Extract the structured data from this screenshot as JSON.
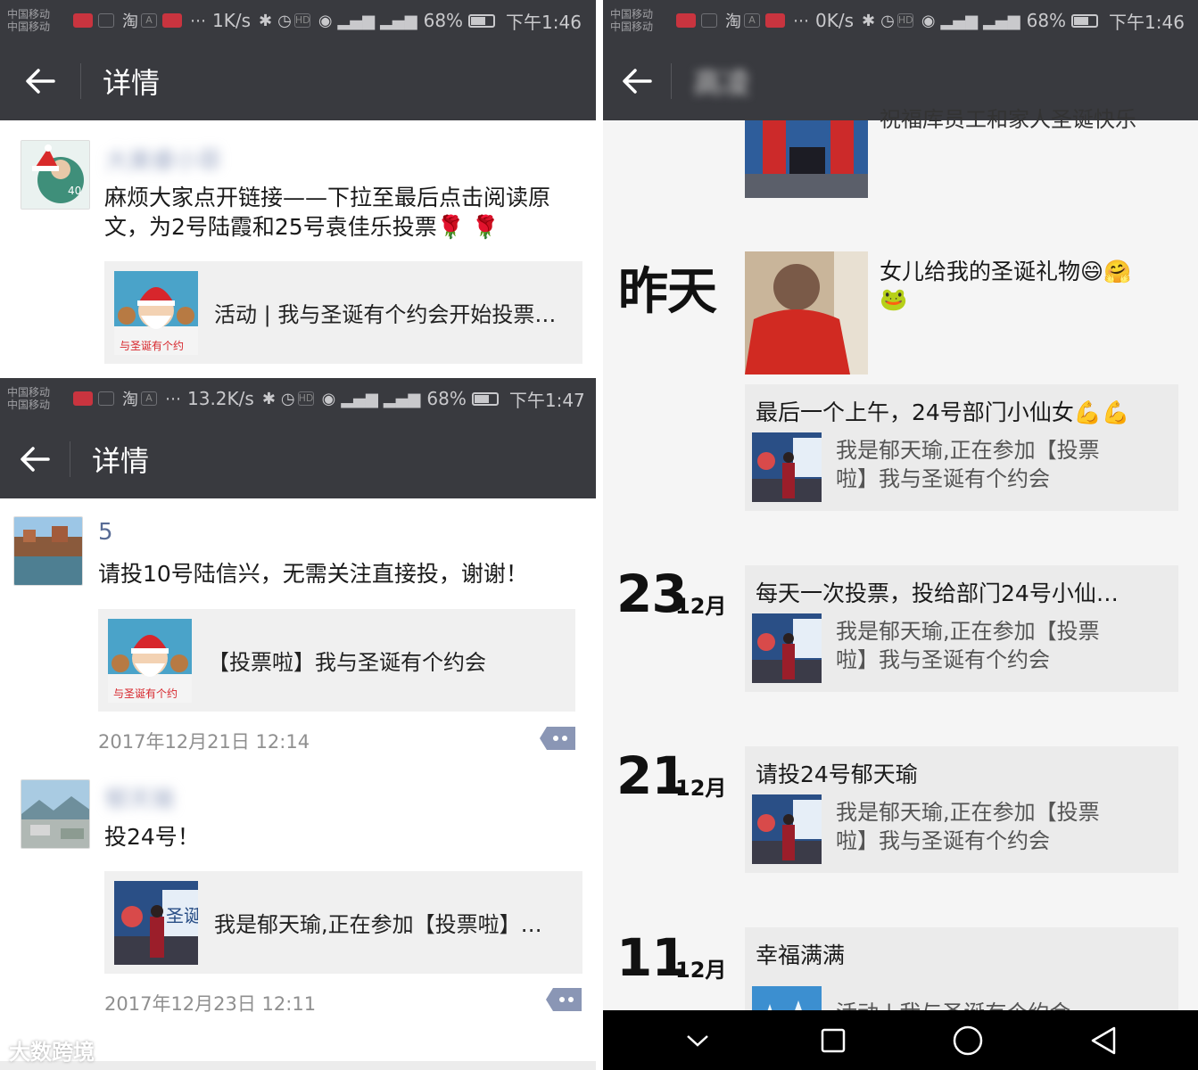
{
  "left_top": {
    "status": {
      "carrier1": "中国移动",
      "carrier2": "中国移动",
      "app1": "淘",
      "app2": "A",
      "speed": "1K/s",
      "net1": "2G",
      "net2": "4G",
      "battery": "68%",
      "battery_level": 0.68,
      "time": "下午1:46"
    },
    "title_bar": {
      "title": "详情"
    },
    "post": {
      "nickname": "大美睿小菲",
      "text": "麻烦大家点开链接——下拉至最后点击阅读原文，为2号陆霞和25号袁佳乐投票🌹 🌹",
      "link_card": {
        "text": "活动 | 我与圣诞有个约会开始投票…",
        "thumb_text": "与圣诞有个约"
      }
    }
  },
  "left_bottom": {
    "status": {
      "carrier1": "中国移动",
      "carrier2": "中国移动",
      "app1": "淘",
      "app2": "A",
      "speed": "13.2K/s",
      "net1": "2G",
      "net2": "4G",
      "battery": "68%",
      "battery_level": 0.68,
      "time": "下午1:47"
    },
    "title_bar": {
      "title": "详情"
    },
    "posts": [
      {
        "nickname": "5",
        "text": "请投10号陆信兴，无需关注直接投，谢谢！",
        "link_card": {
          "text": "【投票啦】我与圣诞有个约会",
          "thumb_text": "与圣诞有个约"
        },
        "timestamp": "2017年12月21日 12:14"
      },
      {
        "nickname": "郁天瑜",
        "text": "投24号！",
        "link_card": {
          "text": "我是郁天瑜,正在参加【投票啦】…",
          "thumb_text": "圣诞"
        },
        "timestamp": "2017年12月23日 12:11"
      }
    ]
  },
  "right": {
    "status": {
      "carrier1": "中国移动",
      "carrier2": "中国移动",
      "app1": "淘",
      "app2": "A",
      "speed": "0K/s",
      "net1": "2G",
      "net2": "4G",
      "battery": "68%",
      "battery_level": 0.68,
      "time": "下午1:46"
    },
    "title_bar": {
      "title": "高凌"
    },
    "top_partial_text": "祝福库员工和家人圣诞快乐",
    "entries": [
      {
        "day": "昨天",
        "month": "",
        "text": "女儿给我的圣诞礼物😄🤗",
        "text2": "🐸"
      },
      {
        "card_title": "最后一个上午，24号部门小仙女💪💪",
        "card_line1": "我是郁天瑜,正在参加【投票",
        "card_line2": "啦】我与圣诞有个约会"
      },
      {
        "day": "23",
        "month": "12月",
        "card_title": "每天一次投票，投给部门24号小仙…",
        "card_line1": "我是郁天瑜,正在参加【投票",
        "card_line2": "啦】我与圣诞有个约会"
      },
      {
        "day": "21",
        "month": "12月",
        "card_title": "请投24号郁天瑜",
        "card_line1": "我是郁天瑜,正在参加【投票",
        "card_line2": "啦】我与圣诞有个约会"
      },
      {
        "day": "11",
        "month": "12月",
        "card_title": "幸福满满",
        "card_line1": "活动 | 我与圣诞有个约会"
      }
    ]
  },
  "watermark": "大数跨境",
  "icons": {
    "back": "arrow-left-icon",
    "comment": "comment-dots-icon",
    "nav_back": "triangle-back-icon",
    "nav_home": "circle-home-icon",
    "nav_recent": "square-recent-icon",
    "nav_down": "chevron-down-icon"
  },
  "colors": {
    "header": "#393a3f",
    "nickname": "#576b95",
    "card_bg": "#f0f0f0",
    "timeline_bg": "#f5f5f5"
  }
}
